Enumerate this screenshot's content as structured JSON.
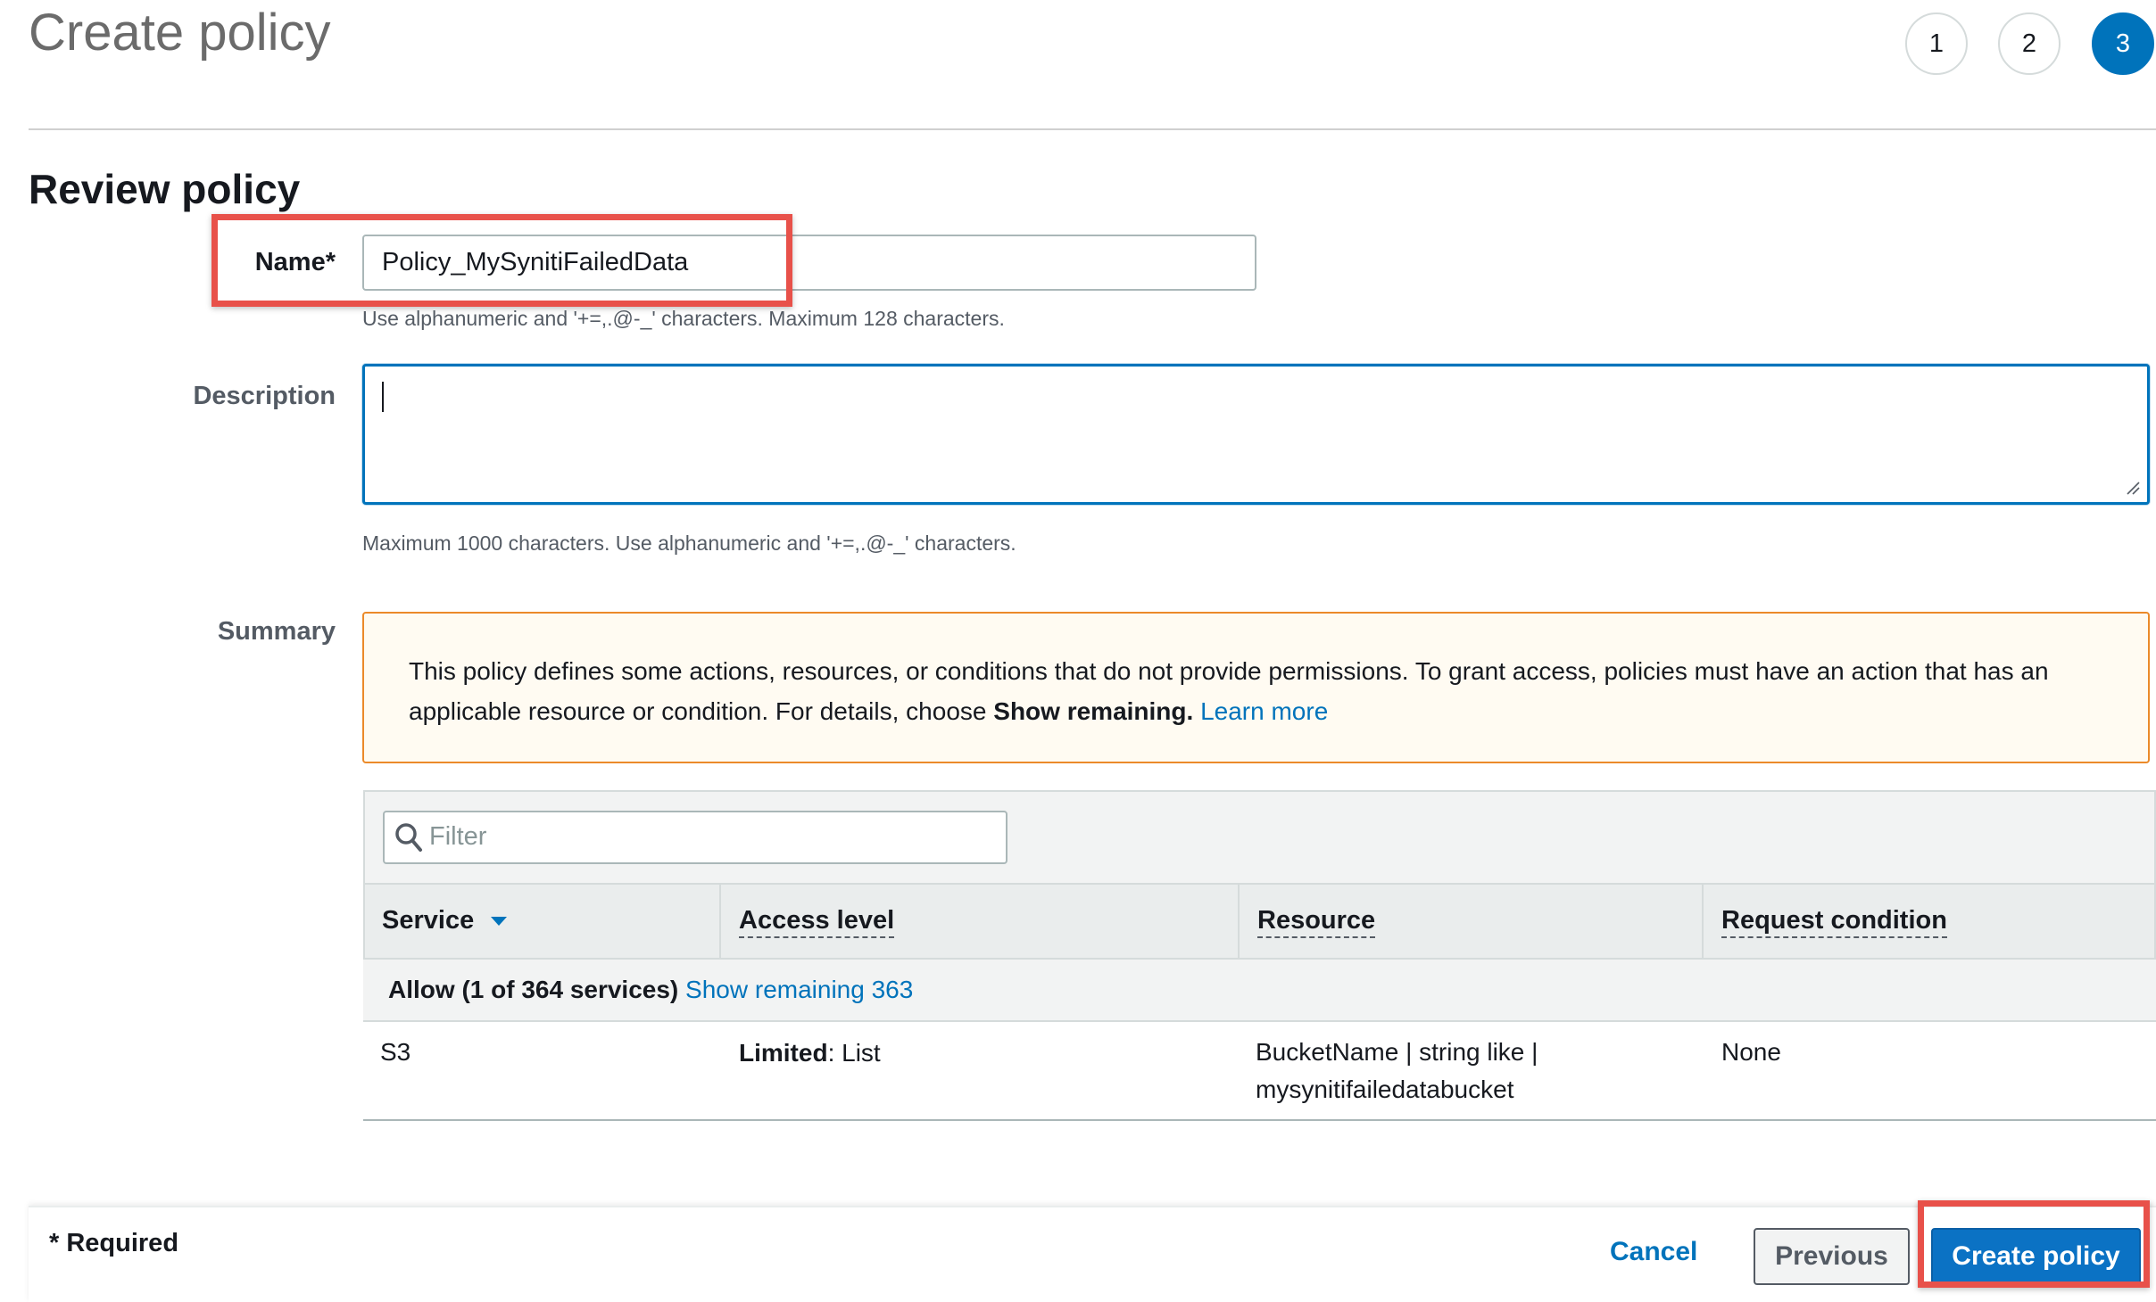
{
  "header": {
    "title": "Create policy",
    "steps": [
      "1",
      "2",
      "3"
    ],
    "active_step": "3"
  },
  "review": {
    "title": "Review policy",
    "name_label": "Name*",
    "name_value": "Policy_MySynitiFailedData",
    "name_help": "Use alphanumeric and '+=,.@-_' characters. Maximum 128 characters.",
    "description_label": "Description",
    "description_value": "",
    "description_help": "Maximum 1000 characters. Use alphanumeric and '+=,.@-_' characters.",
    "summary_label": "Summary"
  },
  "alert": {
    "text_before": "This policy defines some actions, resources, or conditions that do not provide permissions. To grant access, policies must have an action that has an applicable resource or condition. For details, choose ",
    "bold_text": "Show remaining.",
    "link_text": "Learn more"
  },
  "table": {
    "filter_placeholder": "Filter",
    "columns": {
      "service": "Service",
      "access_level": "Access level",
      "resource": "Resource",
      "request_condition": "Request condition"
    },
    "group": {
      "label": "Allow (1 of 364 services)",
      "show_remaining": "Show remaining 363"
    },
    "rows": [
      {
        "service": "S3",
        "access_level_bold": "Limited",
        "access_level_rest": ": List",
        "resource_line1": "BucketName | string like |",
        "resource_line2": "mysynitifailedatabucket",
        "request_condition": "None"
      }
    ]
  },
  "footer": {
    "required": "* Required",
    "cancel": "Cancel",
    "previous": "Previous",
    "create": "Create policy"
  },
  "colors": {
    "accent": "#0073bb",
    "highlight_box": "#e8514a",
    "alert_border": "#eb8a2a"
  }
}
